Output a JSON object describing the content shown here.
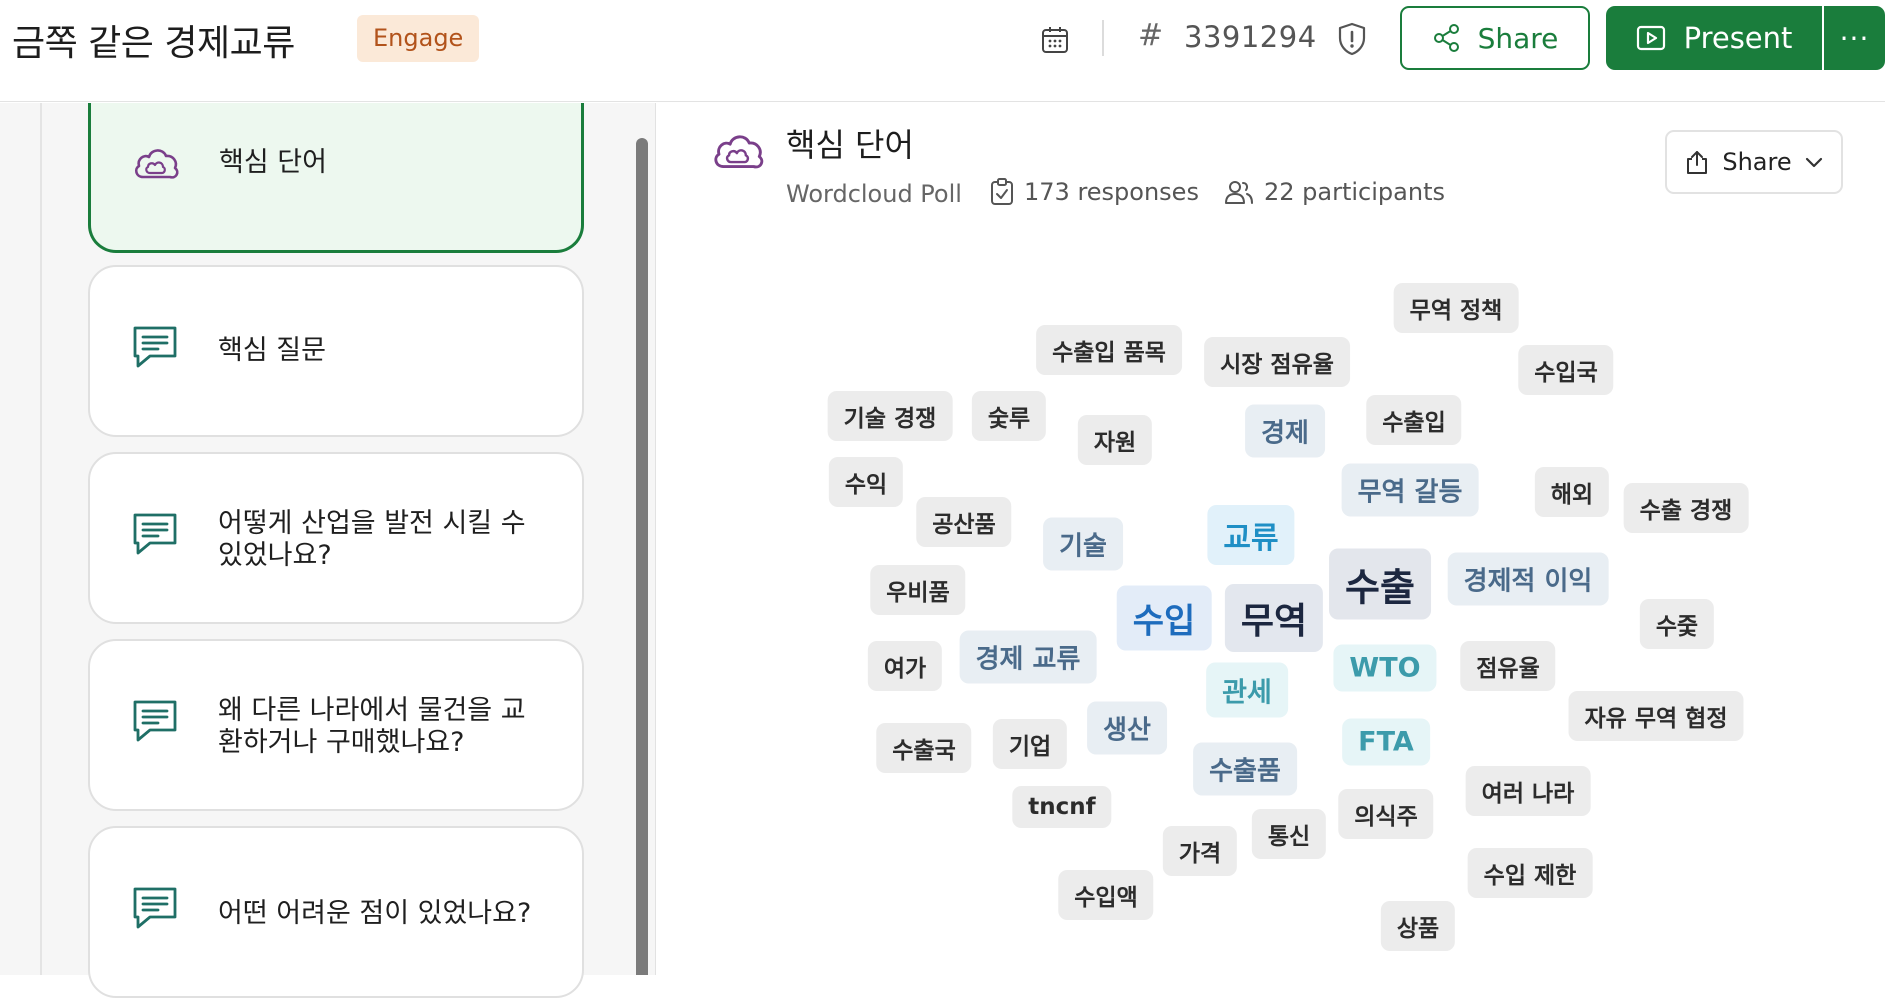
{
  "header": {
    "title": "금쪽 같은 경제교류",
    "badge": "Engage",
    "hash": "#",
    "code": "3391294",
    "share_label": "Share",
    "present_label": "Present",
    "more_label": "···"
  },
  "sidebar": {
    "cards": [
      {
        "label": "핵심 단어",
        "icon": "wordcloud-icon"
      },
      {
        "label": "핵심 질문",
        "icon": "comment-icon"
      },
      {
        "label": "어떻게 산업을 발전 시킬 수 있었나요?",
        "icon": "comment-icon"
      },
      {
        "label": "왜 다른 나라에서 물건을 교환하거나 구매했나요?",
        "icon": "comment-icon"
      },
      {
        "label": "어떤 어려운 점이 있었나요?",
        "icon": "comment-icon"
      }
    ]
  },
  "poll": {
    "title": "핵심 단어",
    "type": "Wordcloud Poll",
    "responses": "173 responses",
    "participants": "22 participants",
    "share_label": "Share"
  },
  "wordcloud": {
    "words": [
      "무역 정책",
      "수출입 품목",
      "시장 점유율",
      "수입국",
      "기술 경쟁",
      "숯루",
      "자원",
      "경제",
      "수출입",
      "수익",
      "무역 갈등",
      "해외",
      "수출 경쟁",
      "공산품",
      "기술",
      "교류",
      "수출",
      "경제적 이익",
      "우비품",
      "수입",
      "무역",
      "수줓",
      "여가",
      "경제 교류",
      "WTO",
      "점유율",
      "관세",
      "자유 무역 협정",
      "수출국",
      "기업",
      "생산",
      "FTA",
      "수출품",
      "여러 나라",
      "tncnf",
      "의식주",
      "통신",
      "가격",
      "수입 제한",
      "수입액",
      "상품"
    ]
  },
  "colors": {
    "brand_green": "#1a7d3c",
    "badge_bg": "#fbe9d8",
    "badge_text": "#b2531b",
    "icon_purple": "#7a3f8a",
    "icon_teal": "#1f6f66"
  }
}
